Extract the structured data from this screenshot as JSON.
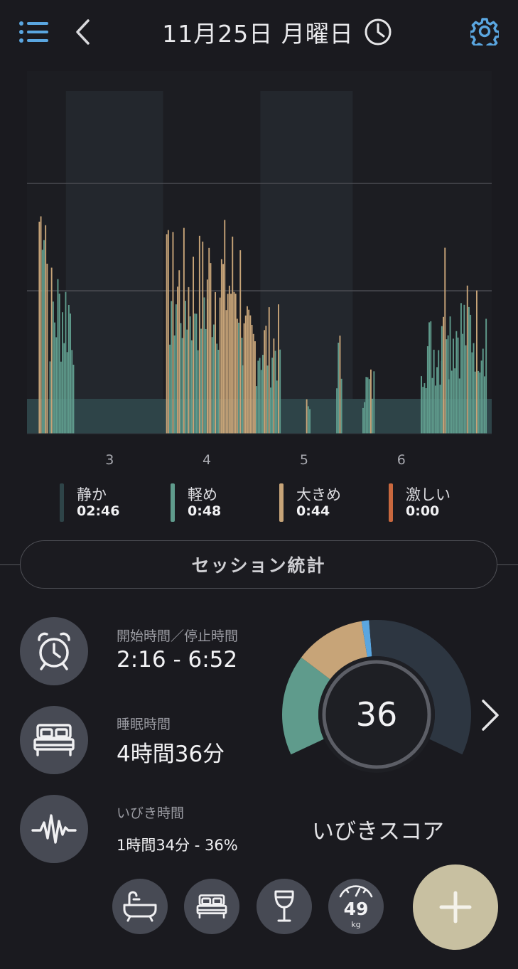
{
  "header": {
    "date_title": "11月25日 月曜日"
  },
  "colors": {
    "quiet": "#2e4448",
    "light": "#5f9b8c",
    "loud": "#c7a478",
    "epic": "#c9683e",
    "accent_blue": "#5aa6e0",
    "add_button": "#c8c0a1"
  },
  "chart_data": {
    "type": "bar",
    "xlabel": "",
    "ylabel": "",
    "x_ticks": [
      "3",
      "4",
      "5",
      "6"
    ],
    "series": [
      {
        "name": "静か",
        "color": "#2e4448"
      },
      {
        "name": "軽め",
        "color": "#5f9b8c"
      },
      {
        "name": "大きめ",
        "color": "#c7a478"
      },
      {
        "name": "激しい",
        "color": "#c9683e"
      }
    ],
    "session_start": "2:16",
    "session_end": "6:52",
    "quiet_level": 0.15,
    "clusters": [
      {
        "from": 2.27,
        "to": 2.36,
        "peak": 1.0,
        "type": "loud"
      },
      {
        "from": 2.38,
        "to": 2.63,
        "peak": 0.72,
        "type": "light"
      },
      {
        "from": 3.58,
        "to": 4.0,
        "peak": 0.83,
        "type": "mix"
      },
      {
        "from": 4.0,
        "to": 4.36,
        "peak": 0.88,
        "type": "loud"
      },
      {
        "from": 4.36,
        "to": 4.76,
        "peak": 0.52,
        "type": "mix"
      },
      {
        "from": 5.02,
        "to": 5.06,
        "peak": 0.15,
        "type": "light"
      },
      {
        "from": 5.33,
        "to": 5.38,
        "peak": 0.42,
        "type": "light"
      },
      {
        "from": 5.6,
        "to": 5.72,
        "peak": 0.28,
        "type": "light"
      },
      {
        "from": 6.2,
        "to": 6.41,
        "peak": 0.5,
        "type": "light"
      },
      {
        "from": 6.41,
        "to": 6.48,
        "peak": 0.86,
        "type": "loud"
      },
      {
        "from": 6.48,
        "to": 6.88,
        "peak": 0.62,
        "type": "light"
      }
    ]
  },
  "legend": [
    {
      "name": "静か",
      "value": "02:46",
      "color": "#2e4448"
    },
    {
      "name": "軽め",
      "value": "0:48",
      "color": "#5f9b8c"
    },
    {
      "name": "大きめ",
      "value": "0:44",
      "color": "#c7a478"
    },
    {
      "name": "激しい",
      "value": "0:00",
      "color": "#c9683e"
    }
  ],
  "session_button": {
    "label": "セッション統計"
  },
  "stats": {
    "start_stop": {
      "label": "開始時間／停止時間",
      "value": "2:16 - 6:52",
      "icon": "alarm-clock-icon"
    },
    "sleep": {
      "label": "睡眠時間",
      "value": "4時間36分",
      "icon": "bed-icon"
    },
    "snore": {
      "label": "いびき時間",
      "value": "1時間34分 - 36%",
      "icon": "sound-wave-icon"
    }
  },
  "score": {
    "value": "36",
    "label": "いびきスコア",
    "segments": [
      {
        "name": "light",
        "fraction": 0.27,
        "color": "#5f9b8c"
      },
      {
        "name": "loud",
        "fraction": 0.19,
        "color": "#c7a478"
      },
      {
        "name": "marker",
        "fraction": 0.02,
        "color": "#5aa6e0"
      },
      {
        "name": "rest",
        "fraction": 0.52,
        "color": "#2d3641"
      }
    ]
  },
  "quick_actions": [
    {
      "name": "bath-icon"
    },
    {
      "name": "bed-icon"
    },
    {
      "name": "wine-glass-icon"
    },
    {
      "name": "scale-icon",
      "value": "49",
      "unit": "kg"
    }
  ],
  "add_button": {
    "icon": "plus-icon"
  }
}
